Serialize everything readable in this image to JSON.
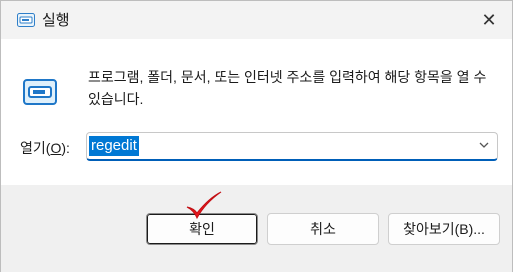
{
  "window": {
    "title": "실행",
    "close_glyph": "✕"
  },
  "content": {
    "description": "프로그램, 폴더, 문서, 또는 인터넷 주소를 입력하여 해당 항목을 열 수 있습니다.",
    "open_label_prefix": "열기(",
    "open_label_mnemonic": "O",
    "open_label_suffix": "):",
    "command_value": "regedit"
  },
  "buttons": {
    "ok": "확인",
    "cancel": "취소",
    "browse": "찾아보기(B)..."
  },
  "colors": {
    "accent": "#0078d4",
    "checkmark": "#e8171d"
  },
  "icons": {
    "title": "run-icon",
    "content": "run-icon",
    "dropdown": "chevron-down-icon",
    "annotation": "red-checkmark"
  }
}
